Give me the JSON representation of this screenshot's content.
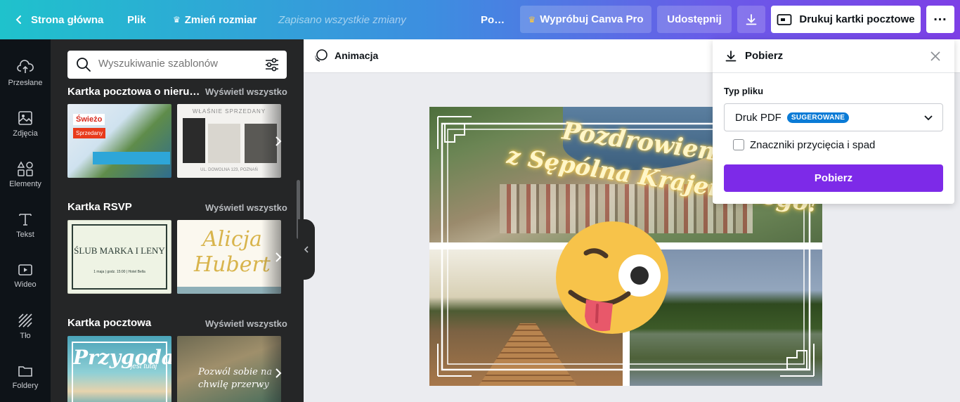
{
  "topbar": {
    "home_label": "Strona główna",
    "file_label": "Plik",
    "resize_label": "Zmień rozmiar",
    "saved_status": "Zapisano wszystkie zmiany",
    "title_truncated": "Po…",
    "pro_label": "Wypróbuj Canva Pro",
    "share_label": "Udostępnij",
    "print_label": "Drukuj kartki pocztowe"
  },
  "rail": {
    "items": [
      {
        "label": "Przesłane",
        "icon": "upload-icon"
      },
      {
        "label": "Zdjęcia",
        "icon": "photos-icon"
      },
      {
        "label": "Elementy",
        "icon": "elements-icon"
      },
      {
        "label": "Tekst",
        "icon": "text-icon"
      },
      {
        "label": "Wideo",
        "icon": "video-icon"
      },
      {
        "label": "Tło",
        "icon": "background-icon"
      },
      {
        "label": "Foldery",
        "icon": "folder-icon"
      }
    ]
  },
  "panel": {
    "search_placeholder": "Wyszukiwanie szablonów",
    "sections": [
      {
        "title": "Kartka pocztowa o nieru…",
        "see_all": "Wyświetl wszystko",
        "thumb1_texts": [
          "Świeżo",
          "Sprzedany"
        ],
        "thumb2_texts": [
          "WŁAŚNIE SPRZEDANY",
          "UL. DOWOLNA 123, POZNAŃ"
        ]
      },
      {
        "title": "Kartka RSVP",
        "see_all": "Wyświetl wszystko",
        "thumb1_texts": [
          "ŚLUB MARKA I LENY",
          "1 maja | godz. 15:00 | Hotel Bella"
        ],
        "thumb2_texts": [
          "Alicja",
          "Hubert"
        ]
      },
      {
        "title": "Kartka pocztowa",
        "see_all": "Wyświetl wszystko",
        "thumb1_texts": [
          "Przygoda",
          "jest tutaj"
        ],
        "thumb2_texts": [
          "Pozwól sobie na",
          "chwilę przerwy"
        ]
      }
    ]
  },
  "editor": {
    "animation_label": "Animacja",
    "card_text_line1": "Pozdrowienia",
    "card_text_line2": "z Sępólna Krajeńskiego!"
  },
  "download": {
    "title": "Pobierz",
    "file_type_label": "Typ pliku",
    "file_type_value": "Druk PDF",
    "suggested_badge": "SUGEROWANE",
    "crop_marks_label": "Znaczniki przycięcia i spad",
    "crop_marks_checked": false,
    "download_button": "Pobierz"
  },
  "colors": {
    "accent_purple": "#7d2ae8",
    "badge_blue": "#0a7bd6",
    "rail_bg": "#0e1318",
    "panel_bg": "#252627"
  }
}
